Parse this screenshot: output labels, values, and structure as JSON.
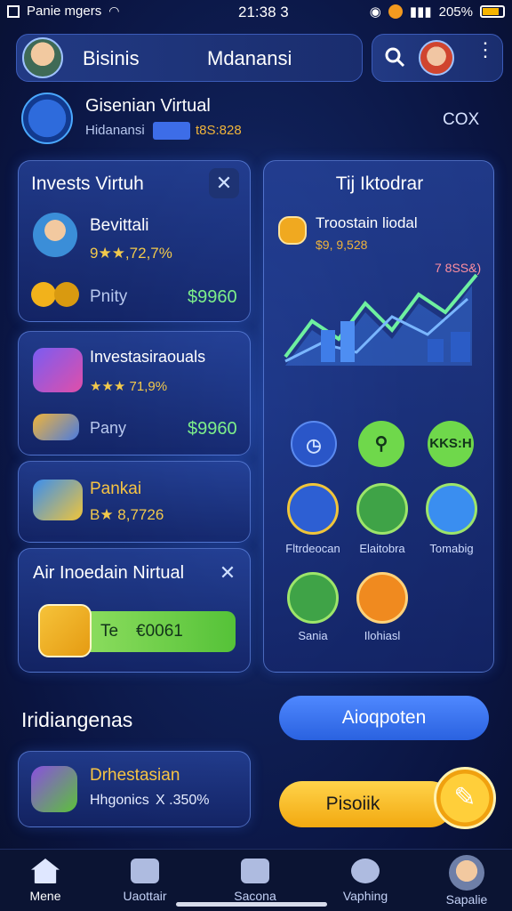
{
  "status_bar": {
    "left_text": "Panie mgers",
    "time": "21:38 3",
    "battery": "205%"
  },
  "header": {
    "tab_left": "Bisinis",
    "tab_right": "Mdanansi"
  },
  "account": {
    "title": "Gisenian Virtual",
    "subtitle": "Hidanansi",
    "value": "t8S:828",
    "right_label": "COX"
  },
  "invest_card": {
    "title": "Invests Virtuh",
    "item1": {
      "name": "Bevittali",
      "rating": "9★★,72,7%"
    },
    "item1_row": {
      "label": "Pnity",
      "value": "$9960"
    }
  },
  "card2": {
    "name": "Investasiraouals",
    "rating": "★★★ 71,9%",
    "row_label": "Pany",
    "row_value": "$9960"
  },
  "card3": {
    "name": "Pankai",
    "rating": "B★ 8,7726"
  },
  "card4": {
    "title": "Air Inoedain Nirtual",
    "input_prefix": "Te",
    "input_value": "€0061"
  },
  "right_panel": {
    "title": "Tij Iktodrar",
    "sub_title": "Troostain liodal",
    "sub_value": "$9, 9,528",
    "chart_badge": "7 8SS&)",
    "round_buttons": [
      "",
      "",
      "KKS:H"
    ],
    "apps": [
      {
        "label": "Fltrdeocan"
      },
      {
        "label": "Elaitobra"
      },
      {
        "label": "Tomabig"
      },
      {
        "label": "Sania"
      },
      {
        "label": "Ilohiasl"
      }
    ]
  },
  "section": {
    "heading": "Iridiangenas",
    "button_primary": "Aioqpoten",
    "list_title": "Drhestasian",
    "list_sub": "Hhgonics",
    "list_value": "X .350%",
    "button_yellow": "Pisoiik"
  },
  "nav": {
    "items": [
      "Mene",
      "Uaottair",
      "Sacona",
      "Vaphing",
      "Sapalie"
    ]
  },
  "colors": {
    "accent_blue": "#2f6df0",
    "accent_green": "#7ef08a",
    "accent_yellow": "#f7c11a"
  }
}
